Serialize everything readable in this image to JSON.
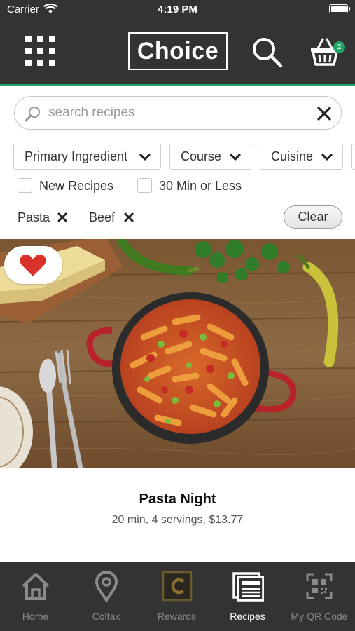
{
  "status_bar": {
    "carrier": "Carrier",
    "time": "4:19 PM"
  },
  "header": {
    "logo": "Choice",
    "cart_count": "2",
    "colors": {
      "background": "#333333",
      "accent": "#1fa463"
    },
    "icons": [
      "grid-menu-icon",
      "search-icon",
      "basket-icon"
    ]
  },
  "search": {
    "placeholder": "search recipes",
    "value": ""
  },
  "filters": {
    "dropdowns": [
      {
        "label": "Primary Ingredient"
      },
      {
        "label": "Course"
      },
      {
        "label": "Cuisine"
      }
    ],
    "checkboxes": [
      {
        "label": "New Recipes",
        "checked": false
      },
      {
        "label": "30 Min or Less",
        "checked": false
      }
    ],
    "active_tags": [
      {
        "label": "Pasta"
      },
      {
        "label": "Beef"
      }
    ],
    "clear_label": "Clear"
  },
  "recipe": {
    "title": "Pasta Night",
    "meta": "20 min, 4 servings, $13.77",
    "favorited": true,
    "heart_color": "#d9322a"
  },
  "tabbar": {
    "tabs": [
      {
        "label": "Home",
        "icon": "home-icon",
        "active": false
      },
      {
        "label": "Colfax",
        "icon": "location-pin-icon",
        "active": false
      },
      {
        "label": "Rewards",
        "icon": "rewards-icon",
        "active": false
      },
      {
        "label": "Recipes",
        "icon": "recipes-icon",
        "active": true
      },
      {
        "label": "My QR Code",
        "icon": "qr-code-icon",
        "active": false
      }
    ]
  }
}
